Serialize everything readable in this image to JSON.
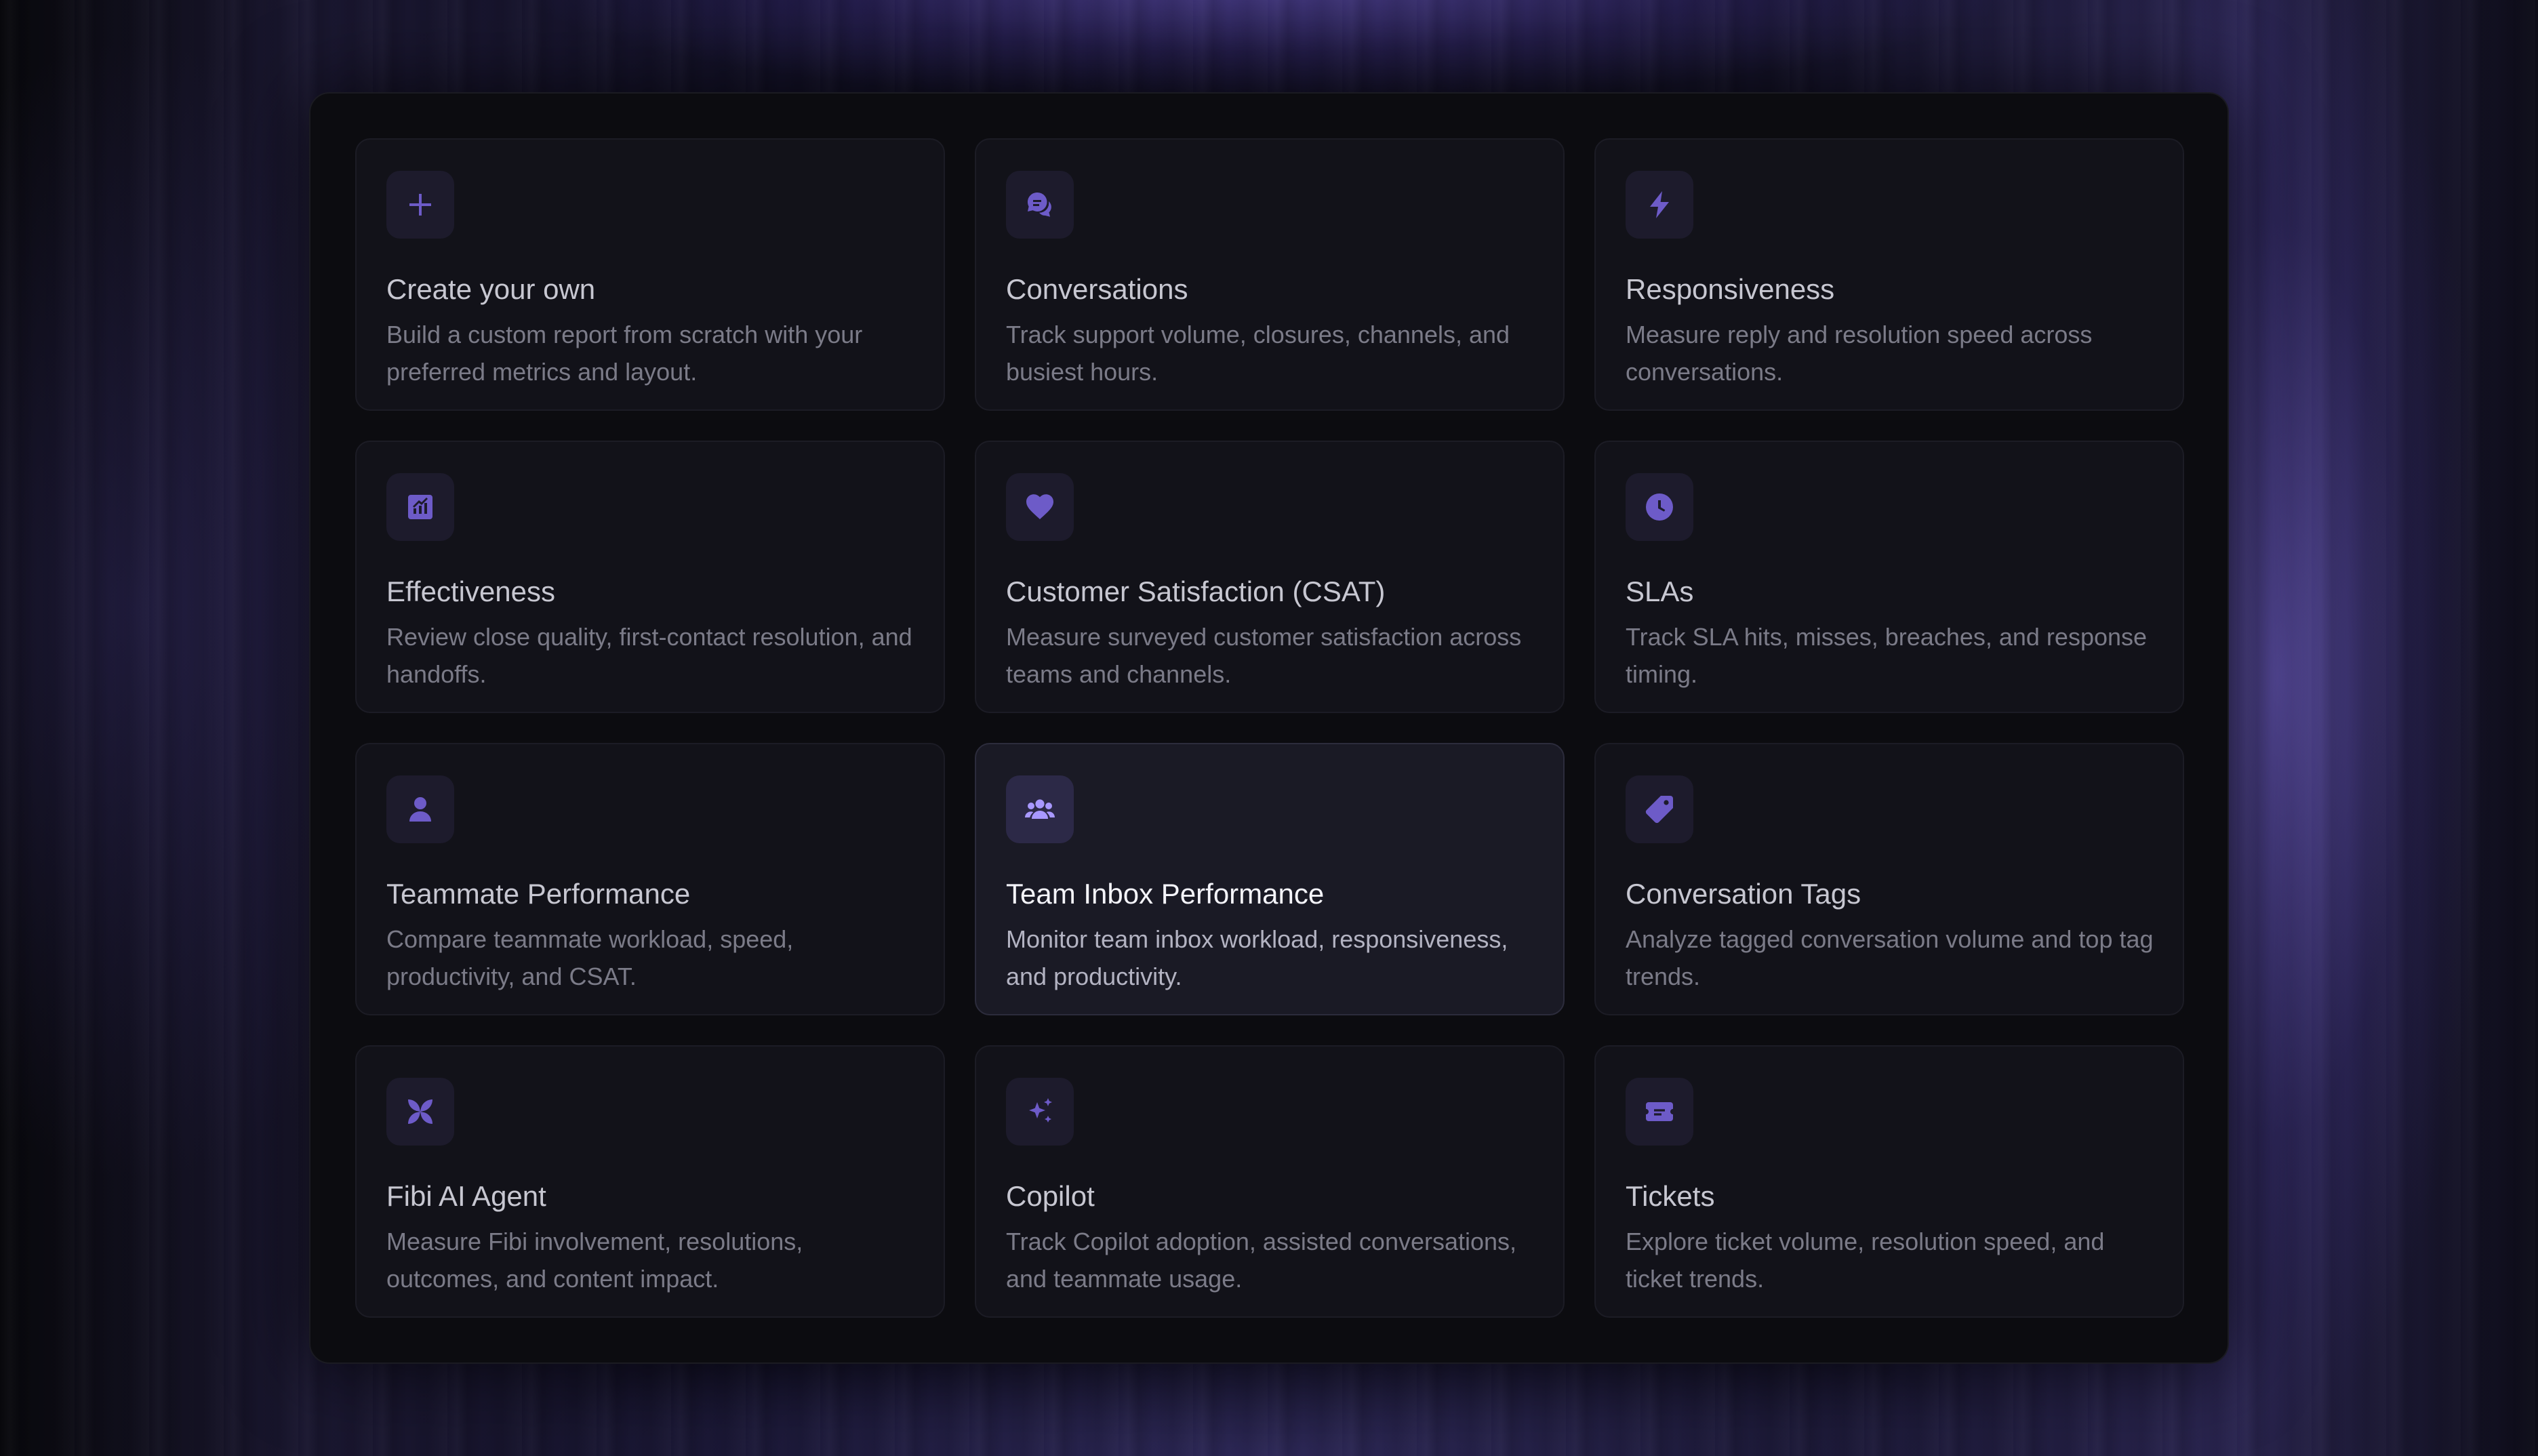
{
  "colors": {
    "accent": "#6d5bc8",
    "accent_active": "#a898ff",
    "card_bg": "#121219",
    "panel_bg": "#0c0c10"
  },
  "cards": [
    {
      "icon": "plus-icon",
      "title": "Create your own",
      "description": "Build a custom report from scratch with your preferred metrics and layout."
    },
    {
      "icon": "chat-bubbles-icon",
      "title": "Conversations",
      "description": "Track support volume, closures, channels, and busiest hours."
    },
    {
      "icon": "lightning-bolt-icon",
      "title": "Responsiveness",
      "description": "Measure reply and resolution speed across conversations."
    },
    {
      "icon": "chart-trend-icon",
      "title": "Effectiveness",
      "description": "Review close quality, first-contact resolution, and handoffs."
    },
    {
      "icon": "heart-icon",
      "title": "Customer Satisfaction (CSAT)",
      "description": "Measure surveyed customer satisfaction across teams and channels."
    },
    {
      "icon": "clock-icon",
      "title": "SLAs",
      "description": "Track SLA hits, misses, breaches, and response timing."
    },
    {
      "icon": "person-icon",
      "title": "Teammate Performance",
      "description": "Compare teammate workload, speed, productivity, and CSAT."
    },
    {
      "icon": "team-icon",
      "title": "Team Inbox Performance",
      "description": "Monitor team inbox workload, responsiveness, and productivity."
    },
    {
      "icon": "tag-icon",
      "title": "Conversation Tags",
      "description": "Analyze tagged conversation volume and top tag trends."
    },
    {
      "icon": "fibi-logo-icon",
      "title": "Fibi AI Agent",
      "description": "Measure Fibi involvement, resolutions, outcomes, and content impact."
    },
    {
      "icon": "sparkles-icon",
      "title": "Copilot",
      "description": "Track Copilot adoption, assisted conversations, and teammate usage."
    },
    {
      "icon": "ticket-icon",
      "title": "Tickets",
      "description": "Explore ticket volume, resolution speed, and ticket trends."
    }
  ]
}
